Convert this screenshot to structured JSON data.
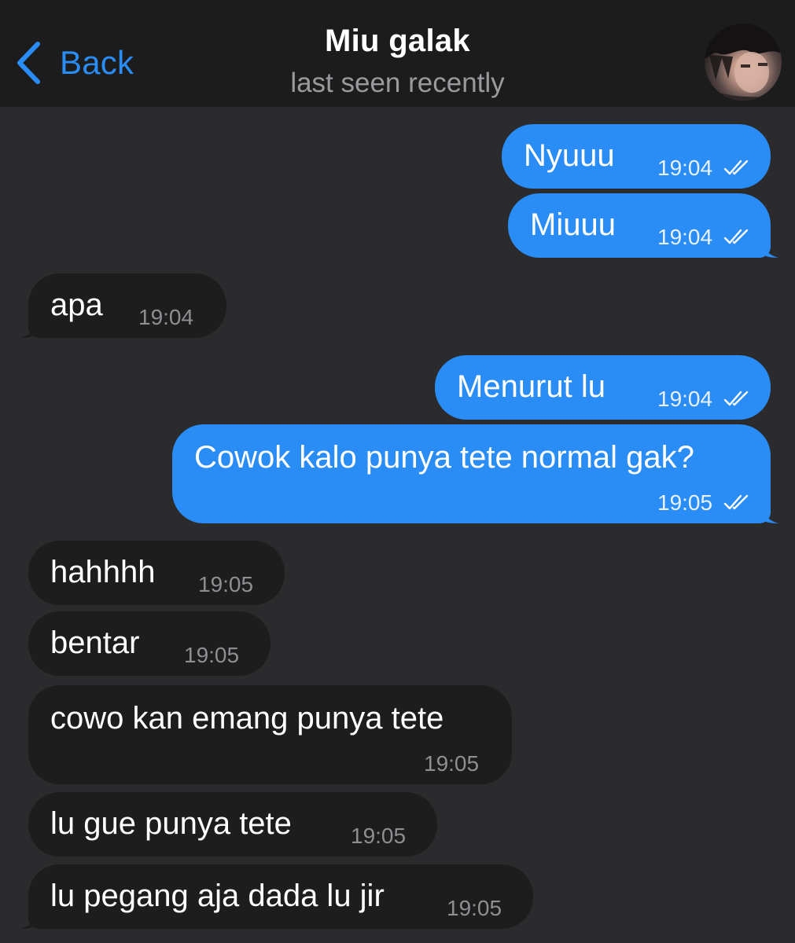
{
  "header": {
    "back_label": "Back",
    "title": "Miu galak",
    "subtitle": "last seen recently",
    "back_icon": "chevron-left-icon",
    "avatar_icon": "contact-avatar"
  },
  "colors": {
    "header_bg": "#1c1c1d",
    "chat_bg": "#2b2b2d",
    "outgoing_bubble": "#2a8cf5",
    "incoming_bubble": "#1d1d1e",
    "accent": "#2a8cf5",
    "subtitle": "#9a9a9e"
  },
  "messages": [
    {
      "direction": "outgoing",
      "text": "Nyuuu",
      "time": "19:04",
      "status": "read"
    },
    {
      "direction": "outgoing",
      "text": "Miuuu",
      "time": "19:04",
      "status": "read"
    },
    {
      "direction": "incoming",
      "text": "apa",
      "time": "19:04"
    },
    {
      "direction": "outgoing",
      "text": "Menurut lu",
      "time": "19:04",
      "status": "read"
    },
    {
      "direction": "outgoing",
      "text": "Cowok kalo punya tete normal gak?",
      "time": "19:05",
      "status": "read"
    },
    {
      "direction": "incoming",
      "text": "hahhhh",
      "time": "19:05"
    },
    {
      "direction": "incoming",
      "text": "bentar",
      "time": "19:05"
    },
    {
      "direction": "incoming",
      "text": "cowo kan emang punya tete",
      "time": "19:05"
    },
    {
      "direction": "incoming",
      "text": "lu gue punya tete",
      "time": "19:05"
    },
    {
      "direction": "incoming",
      "text": "lu pegang aja dada lu jir",
      "time": "19:05"
    }
  ]
}
